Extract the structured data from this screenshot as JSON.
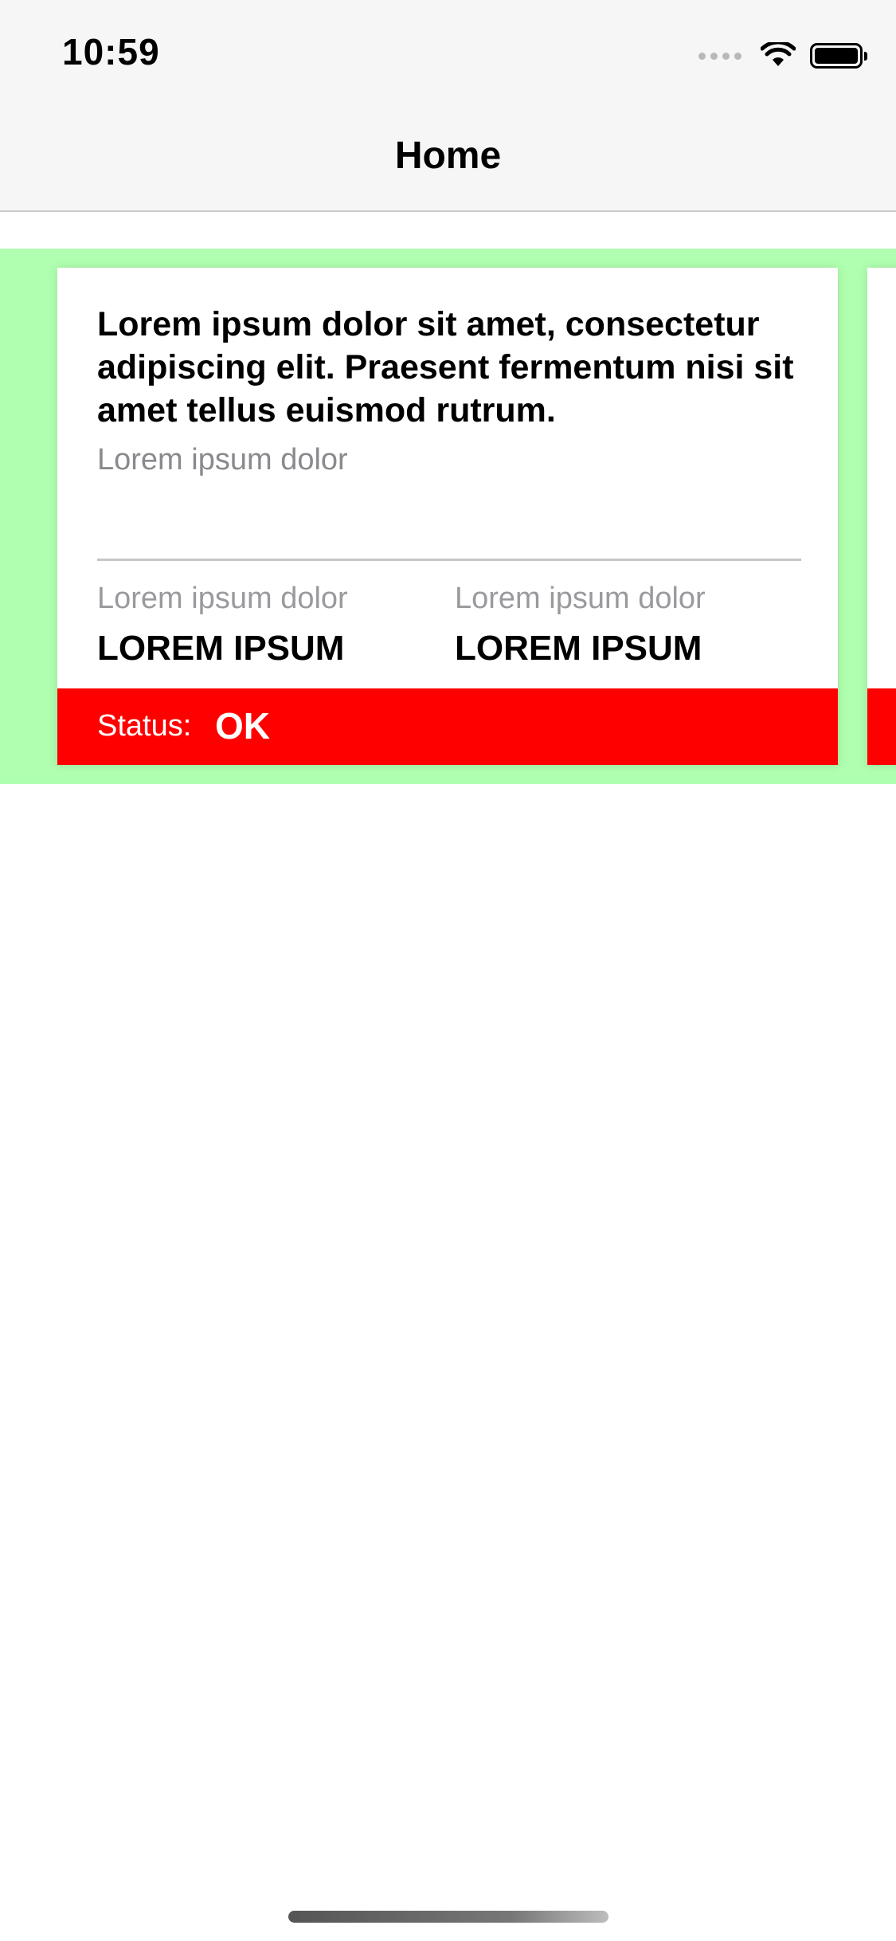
{
  "status_bar": {
    "time": "10:59",
    "signal_icon": "signal-dots-icon",
    "wifi_icon": "wifi-icon",
    "battery_icon": "battery-icon"
  },
  "nav": {
    "title": "Home"
  },
  "carousel": {
    "background_color": "#b0ffb0",
    "cards": [
      {
        "title": "Lorem ipsum dolor sit amet, consectetur adipiscing elit. Praesent fermentum nisi sit amet tellus euismod rutrum.",
        "subtitle": "Lorem ipsum dolor",
        "stats": [
          {
            "label": "Lorem ipsum dolor",
            "value": "LOREM IPSUM"
          },
          {
            "label": "Lorem ipsum dolor",
            "value": "LOREM IPSUM"
          }
        ],
        "status_label": "Status:",
        "status_value": "OK",
        "status_color": "#ff0000"
      }
    ]
  }
}
